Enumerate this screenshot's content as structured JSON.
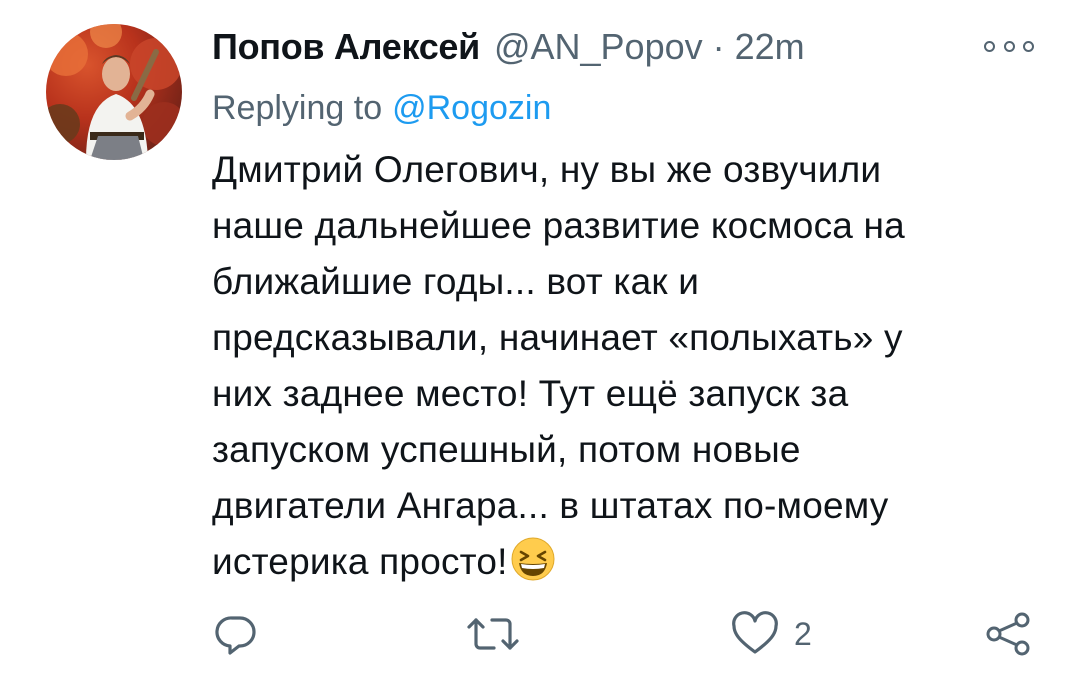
{
  "tweet": {
    "author_name": "Попов Алексей",
    "handle": "@AN_Popov",
    "separator": "·",
    "time": "22m",
    "replying_label": "Replying to",
    "replying_to": "@Rogozin",
    "body_lines": [
      "Дмитрий Олегович, ну вы же озвучили",
      "наше дальнейшее развитие космоса на",
      "ближайшие годы... вот как и",
      "предсказывали, начинает «полыхать» у",
      "них заднее место! Тут ещё запуск за",
      "запуском успешный, потом новые",
      "двигатели Ангара... в штатах по-моему",
      "истерика просто!"
    ],
    "emoji": "grinning-squinting-face-emoji"
  },
  "actions": {
    "reply_icon": "reply-icon",
    "retweet_icon": "retweet-icon",
    "like_icon": "like-icon",
    "like_count": "2",
    "share_icon": "share-icon"
  },
  "colors": {
    "text": "#0f1419",
    "secondary": "#536471",
    "link": "#1d9bf0"
  }
}
